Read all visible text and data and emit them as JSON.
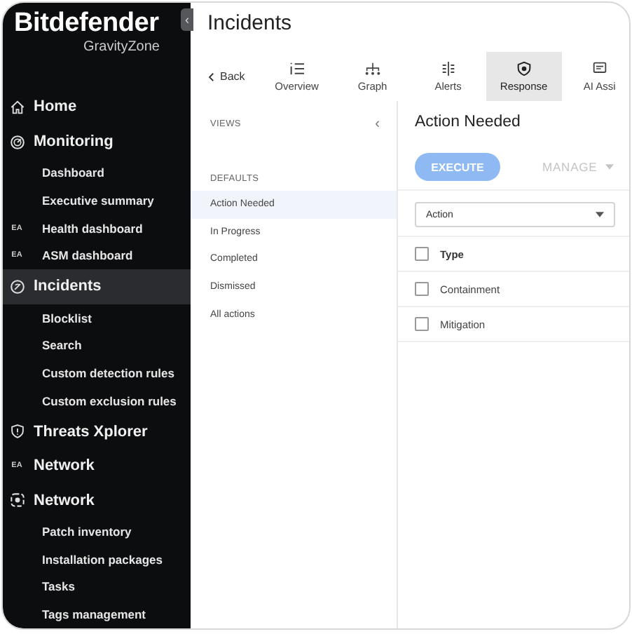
{
  "sidebar": {
    "logo": "Bitdefender",
    "product": "GravityZone",
    "collapse": "‹",
    "items": [
      {
        "kind": "section",
        "label": "Home",
        "selected": false
      },
      {
        "kind": "section",
        "label": "Monitoring",
        "selected": false
      },
      {
        "kind": "link",
        "label": "Dashboard",
        "selected": false
      },
      {
        "kind": "link",
        "label": "Executive summary",
        "selected": false
      },
      {
        "kind": "link",
        "badge": "EA",
        "label": "Health dashboard",
        "selected": false
      },
      {
        "kind": "link",
        "badge": "EA",
        "label": "ASM dashboard",
        "selected": false
      },
      {
        "kind": "section",
        "label": "Incidents",
        "selected": true
      },
      {
        "kind": "link",
        "label": "Blocklist",
        "selected": false
      },
      {
        "kind": "link",
        "label": "Search",
        "selected": false
      },
      {
        "kind": "link",
        "label": "Custom detection rules",
        "selected": false
      },
      {
        "kind": "link",
        "label": "Custom exclusion rules",
        "selected": false
      },
      {
        "kind": "section",
        "label": "Threats Xplorer",
        "selected": false
      },
      {
        "kind": "section",
        "badge": "EA",
        "label": "Network",
        "selected": false
      },
      {
        "kind": "section",
        "label": "Network",
        "selected": false
      },
      {
        "kind": "link",
        "label": "Patch inventory",
        "selected": false
      },
      {
        "kind": "link",
        "label": "Installation packages",
        "selected": false
      },
      {
        "kind": "link",
        "label": "Tasks",
        "selected": false
      },
      {
        "kind": "link",
        "label": "Tags management",
        "selected": false
      }
    ]
  },
  "page": {
    "title": "Incidents",
    "back": "Back",
    "tabs": [
      {
        "label": "Overview",
        "selected": false
      },
      {
        "label": "Graph",
        "selected": false
      },
      {
        "label": "Alerts",
        "selected": false
      },
      {
        "label": "Response",
        "selected": true
      },
      {
        "label": "AI Assi",
        "selected": false
      }
    ]
  },
  "views": {
    "header": "VIEWS",
    "collapse": "‹",
    "group": "DEFAULTS",
    "items": [
      {
        "label": "Action Needed",
        "selected": true
      },
      {
        "label": "In Progress",
        "selected": false
      },
      {
        "label": "Completed",
        "selected": false
      },
      {
        "label": "Dismissed",
        "selected": false
      },
      {
        "label": "All actions",
        "selected": false
      }
    ]
  },
  "panel": {
    "title": "Action Needed",
    "execute": {
      "label": "EXECUTE",
      "disabled": true
    },
    "manage": {
      "label": "MANAGE",
      "disabled": true
    },
    "filter": {
      "value": "Action"
    },
    "table": {
      "header": {
        "label": "Type",
        "checked": false
      },
      "rows": [
        {
          "label": "Containment",
          "checked": false
        },
        {
          "label": "Mitigation",
          "checked": false
        }
      ]
    }
  }
}
